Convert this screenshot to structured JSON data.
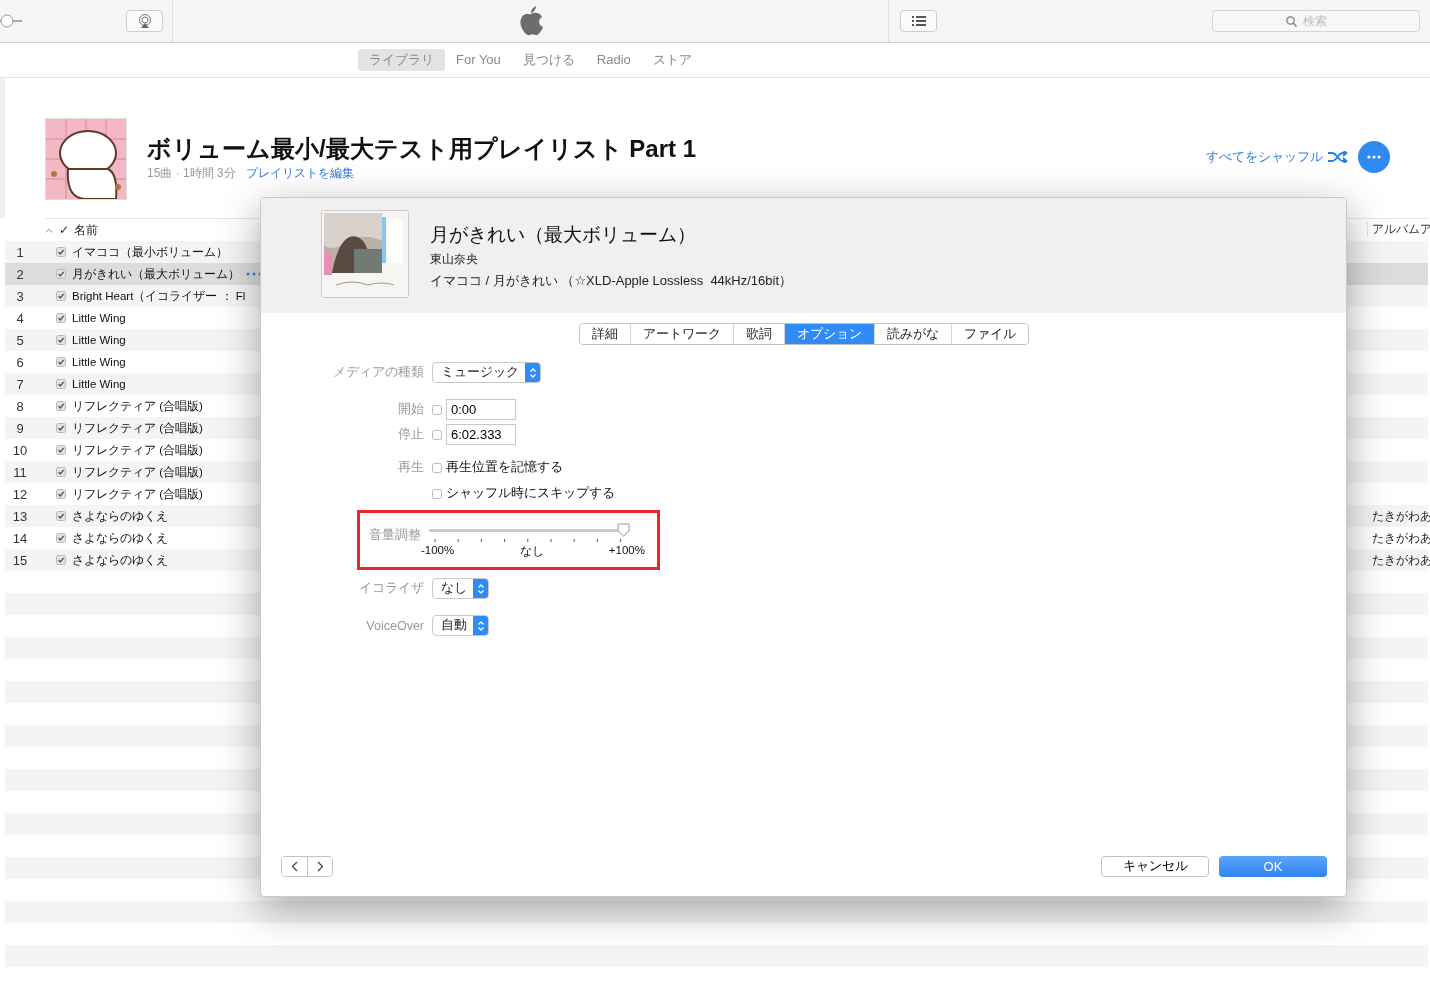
{
  "toolbar": {
    "volume": {
      "level": 0
    },
    "search": {
      "placeholder": "検索"
    }
  },
  "nav": {
    "tabs": [
      {
        "label": "ライブラリ",
        "selected": true
      },
      {
        "label": "For You",
        "selected": false
      },
      {
        "label": "見つける",
        "selected": false
      },
      {
        "label": "Radio",
        "selected": false
      },
      {
        "label": "ストア",
        "selected": false
      }
    ]
  },
  "playlist": {
    "title": "ボリューム最小/最大テスト用プレイリスト Part 1",
    "meta": "15曲 · 1時間 3分",
    "edit_link": "プレイリストを編集",
    "shuffle_link": "すべてをシャッフル"
  },
  "track_list": {
    "check_column": "✓",
    "name_column": "名前",
    "album_artist_column": "アルバムア",
    "rows": [
      {
        "number": "1",
        "checked": true,
        "name": "イマココ（最小ボリューム）",
        "selected": false,
        "more_button": false
      },
      {
        "number": "2",
        "checked": true,
        "name": "月がきれい（最大ボリューム）",
        "selected": true,
        "more_button": true
      },
      {
        "number": "3",
        "checked": true,
        "name": "Bright Heart（イコライザー ： Fl",
        "selected": false,
        "more_button": false
      },
      {
        "number": "4",
        "checked": true,
        "name": "Little Wing",
        "selected": false,
        "more_button": false
      },
      {
        "number": "5",
        "checked": true,
        "name": "Little Wing",
        "selected": false,
        "more_button": false
      },
      {
        "number": "6",
        "checked": true,
        "name": "Little Wing",
        "selected": false,
        "more_button": false
      },
      {
        "number": "7",
        "checked": true,
        "name": "Little Wing",
        "selected": false,
        "more_button": false
      },
      {
        "number": "8",
        "checked": true,
        "name": "リフレクティア (合唱版)",
        "selected": false,
        "more_button": false
      },
      {
        "number": "9",
        "checked": true,
        "name": "リフレクティア (合唱版)",
        "selected": false,
        "more_button": false
      },
      {
        "number": "10",
        "checked": true,
        "name": "リフレクティア (合唱版)",
        "selected": false,
        "more_button": false
      },
      {
        "number": "11",
        "checked": true,
        "name": "リフレクティア (合唱版)",
        "selected": false,
        "more_button": false
      },
      {
        "number": "12",
        "checked": true,
        "name": "リフレクティア (合唱版)",
        "selected": false,
        "more_button": false
      },
      {
        "number": "13",
        "checked": true,
        "name": "さよならのゆくえ",
        "selected": false,
        "more_button": false,
        "album_artist": "たきがわあ"
      },
      {
        "number": "14",
        "checked": true,
        "name": "さよならのゆくえ",
        "selected": false,
        "more_button": false,
        "album_artist": "たきがわあ"
      },
      {
        "number": "15",
        "checked": true,
        "name": "さよならのゆくえ",
        "selected": false,
        "more_button": false,
        "album_artist": "たきがわあ"
      }
    ]
  },
  "dialog": {
    "title": "月がきれい（最大ボリューム）",
    "artist": "東山奈央",
    "album_line": "イマココ / 月がきれい （☆XLD-Apple Lossless  44kHz/16bit）",
    "tabs": [
      {
        "label": "詳細",
        "selected": false
      },
      {
        "label": "アートワーク",
        "selected": false
      },
      {
        "label": "歌詞",
        "selected": false
      },
      {
        "label": "オプション",
        "selected": true
      },
      {
        "label": "読みがな",
        "selected": false
      },
      {
        "label": "ファイル",
        "selected": false
      }
    ],
    "media_kind": {
      "label": "メディアの種類",
      "value": "ミュージック"
    },
    "start": {
      "label": "開始",
      "checked": false,
      "value": "0:00"
    },
    "stop": {
      "label": "停止",
      "checked": false,
      "value": "6:02.333"
    },
    "playback": {
      "label": "再生",
      "options": [
        {
          "label": "再生位置を記憶する",
          "checked": false
        },
        {
          "label": "シャッフル時にスキップする",
          "checked": false
        }
      ]
    },
    "volume": {
      "label": "音量調整",
      "level": 1,
      "tick_labels": [
        "-100%",
        "なし",
        "+100%"
      ],
      "highlighted": true
    },
    "equalizer": {
      "label": "イコライザ",
      "value": "なし"
    },
    "voiceover": {
      "label": "VoiceOver",
      "value": "自動"
    },
    "buttons": {
      "cancel": "キャンセル",
      "ok": "OK"
    }
  }
}
